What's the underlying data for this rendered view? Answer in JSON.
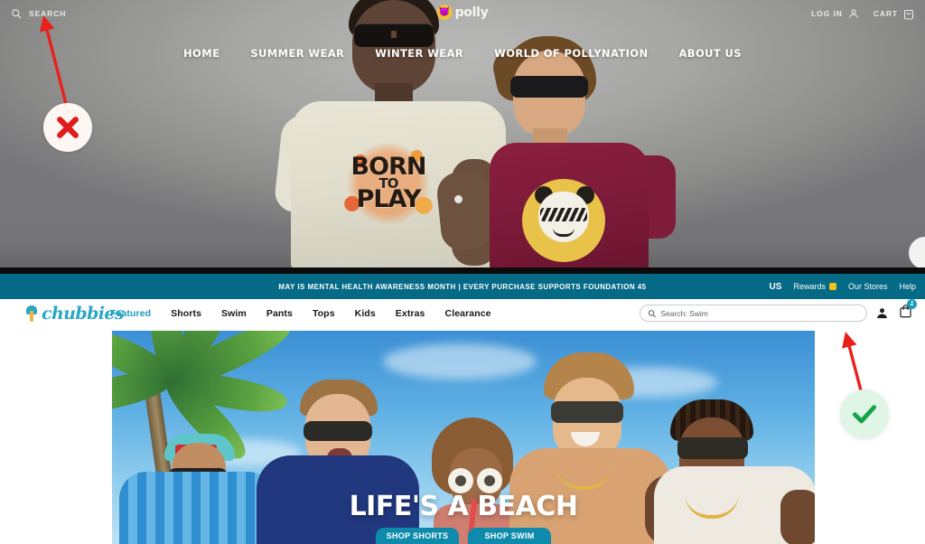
{
  "polly_site": {
    "search_label": "SEARCH",
    "logo_text": "polly",
    "logo_icon": "panda-badge-icon",
    "account_label": "LOG IN",
    "cart_label": "CART",
    "nav": [
      {
        "label": "HOME"
      },
      {
        "label": "SUMMER WEAR"
      },
      {
        "label": "WINTER WEAR"
      },
      {
        "label": "WORLD OF POLLYNATION"
      },
      {
        "label": "ABOUT US"
      }
    ],
    "hero_graphics": {
      "left_tee_line1": "BORN",
      "left_tee_line2": "TO",
      "left_tee_line3": "PLAY"
    }
  },
  "announcement": {
    "message": "MAY IS MENTAL HEALTH AWARENESS MONTH | EVERY PURCHASE SUPPORTS FOUNDATION 45",
    "region": "US",
    "rewards": "Rewards",
    "stores": "Our Stores",
    "help": "Help",
    "bg_color": "#046a85"
  },
  "chubbies": {
    "logo_text": "chubbies",
    "logo_icon": "palm-tree-icon",
    "accent_color": "#1a9cbb",
    "links": [
      {
        "label": "Featured",
        "active": true
      },
      {
        "label": "Shorts",
        "active": false
      },
      {
        "label": "Swim",
        "active": false
      },
      {
        "label": "Pants",
        "active": false
      },
      {
        "label": "Tops",
        "active": false
      },
      {
        "label": "Kids",
        "active": false
      },
      {
        "label": "Extras",
        "active": false
      },
      {
        "label": "Clearance",
        "active": false
      }
    ],
    "search": {
      "placeholder": "Search: Swim",
      "value": ""
    },
    "account_icon": "user-icon",
    "cart_icon": "cart-icon",
    "cart_count": "1"
  },
  "beach_hero": {
    "headline": "LIFE'S A BEACH",
    "button_primary": "SHOP SHORTS",
    "button_secondary": "SHOP SWIM",
    "button_color": "#0e8bab"
  },
  "annotations": {
    "reject": {
      "symbol": "✕",
      "color": "#e01b1b",
      "meaning": "incorrect-target"
    },
    "accept": {
      "symbol": "✓",
      "color": "#16a34a",
      "meaning": "correct-target"
    }
  }
}
